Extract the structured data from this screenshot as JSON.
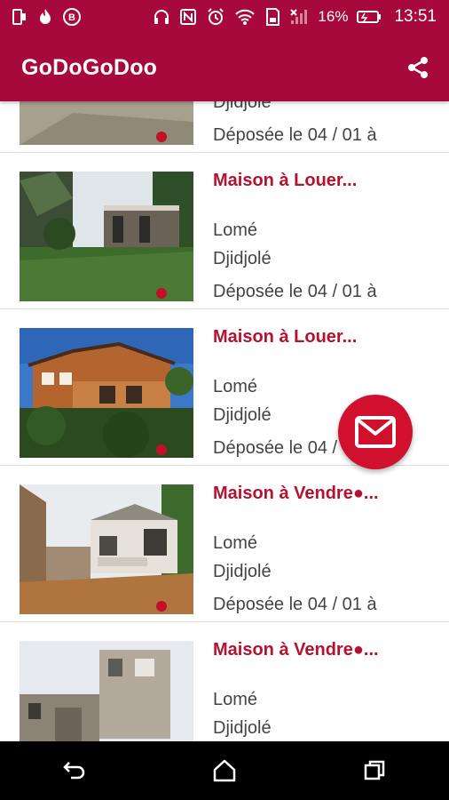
{
  "status_bar": {
    "battery": "16%",
    "time": "13:51"
  },
  "app": {
    "title": "GoDoGoDoo"
  },
  "listings": [
    {
      "title": "",
      "city": "",
      "district": "Djidjolé",
      "date": "Déposée le 04 / 01 à"
    },
    {
      "title": "Maison à Louer...",
      "city": "Lomé",
      "district": "Djidjolé",
      "date": "Déposée le 04 / 01 à"
    },
    {
      "title": "Maison à Louer...",
      "city": "Lomé",
      "district": "Djidjolé",
      "date": "Déposée le 04 / 01 à"
    },
    {
      "title": "Maison à Vendre●...",
      "city": "Lomé",
      "district": "Djidjolé",
      "date": "Déposée le 04 / 01 à"
    },
    {
      "title": "Maison à Vendre●...",
      "city": "Lomé",
      "district": "Djidjolé",
      "date": ""
    }
  ],
  "colors": {
    "primary": "#a8093c",
    "accent": "#d0102c",
    "title_text": "#b5122f"
  },
  "icons": {
    "share": "share-icon",
    "fab": "mail-icon",
    "back": "back-icon",
    "home": "home-icon",
    "recents": "recents-icon"
  }
}
